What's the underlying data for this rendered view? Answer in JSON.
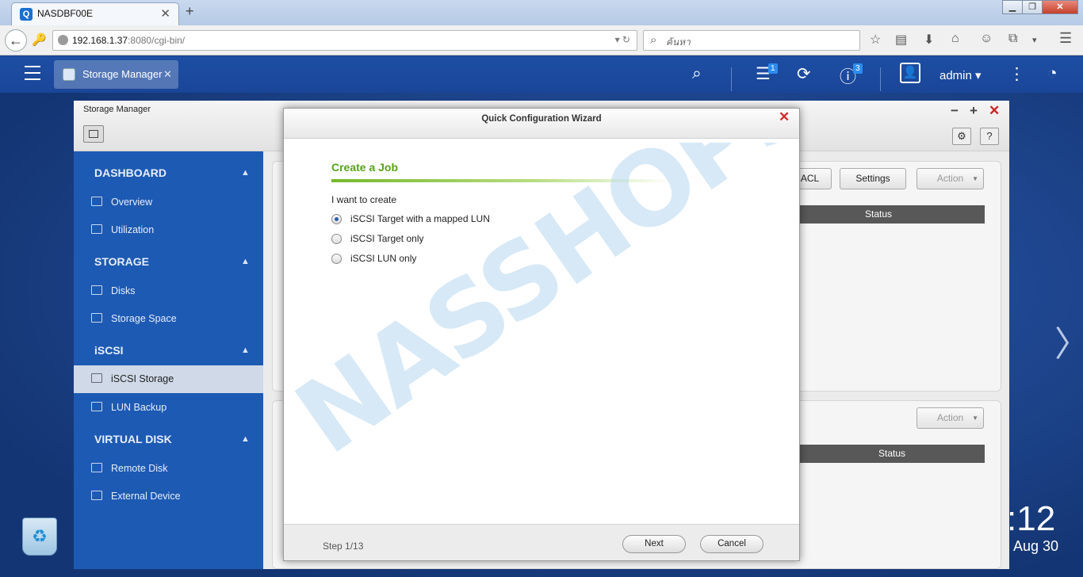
{
  "browser": {
    "tab_title": "NASDBF00E",
    "tab_favicon": "Q",
    "new_tab": "+",
    "url_host": "192.168.1.37",
    "url_rest": ":8080/cgi-bin/",
    "search_placeholder": "ค้นหา"
  },
  "nas": {
    "app_tab_label": "Storage Manager",
    "notification_count": "1",
    "info_count": "3",
    "user": "admin ▾"
  },
  "storage_manager": {
    "title": "Storage Manager",
    "sidebar": [
      {
        "section": "DASHBOARD",
        "items": [
          "Overview",
          "Utilization"
        ]
      },
      {
        "section": "STORAGE",
        "items": [
          "Disks",
          "Storage Space"
        ]
      },
      {
        "section": "iSCSI",
        "items": [
          "iSCSI Storage",
          "LUN Backup"
        ]
      },
      {
        "section": "VIRTUAL DISK",
        "items": [
          "Remote Disk",
          "External Device"
        ]
      }
    ],
    "selected_item": "iSCSI Storage",
    "panel1": {
      "acl": "ACL",
      "settings": "Settings",
      "action": "Action",
      "col_status": "Status"
    },
    "panel2": {
      "action": "Action",
      "col_status": "Status"
    }
  },
  "wizard": {
    "title": "Quick Configuration Wizard",
    "step_title": "Create a Job",
    "prompt": "I want to create",
    "options": [
      "iSCSI Target with a mapped LUN",
      "iSCSI Target only",
      "iSCSI LUN only"
    ],
    "selected_option": "iSCSI Target with a mapped LUN",
    "step": "Step 1/13",
    "next": "Next",
    "cancel": "Cancel"
  },
  "desktop": {
    "clock": ":12",
    "date": "Aug 30",
    "watermark": "NASSHOPS.net"
  },
  "colors": {
    "nas_bar": "#1d4ea3",
    "sidebar": "#1d5ab3",
    "wizard_accent": "#58a21a",
    "close_red": "#d42b2b"
  }
}
